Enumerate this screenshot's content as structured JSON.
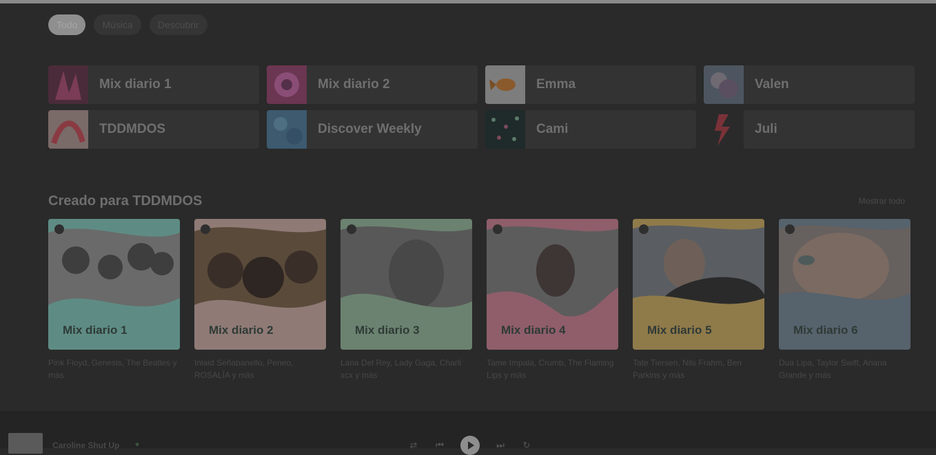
{
  "filters": [
    {
      "label": "Todo",
      "active": true
    },
    {
      "label": "Música",
      "active": false
    },
    {
      "label": "Descubrir",
      "active": false
    }
  ],
  "quick_access": [
    {
      "label": "Mix diario 1",
      "art": "art-mix1"
    },
    {
      "label": "Mix diario 2",
      "art": "art-mix2"
    },
    {
      "label": "Emma",
      "art": "art-emma"
    },
    {
      "label": "Valen",
      "art": "art-valen"
    },
    {
      "label": "TDDMDOS",
      "art": "art-tddmdos"
    },
    {
      "label": "Discover Weekly",
      "art": "art-discover"
    },
    {
      "label": "Cami",
      "art": "art-cami"
    },
    {
      "label": "Juli",
      "art": "art-juli"
    }
  ],
  "section": {
    "title": "Creado para TDDMDOS",
    "show_all": "Mostrar todo"
  },
  "mixes": [
    {
      "label": "Mix diario 1",
      "desc": "Pink Floyd, Genesis, The Beatles y más",
      "color": "#5e8c84"
    },
    {
      "label": "Mix diario 2",
      "desc": "Inlaid Señabanello, Peneo, ROSALÍA y más",
      "color": "#8f7a76"
    },
    {
      "label": "Mix diario 3",
      "desc": "Lana Del Rey, Lady Gaga, Charli xcx y más",
      "color": "#6b8270"
    },
    {
      "label": "Mix diario 4",
      "desc": "Tame Impala, Crumb, The Flaming Lips y más",
      "color": "#8f5e6a"
    },
    {
      "label": "Mix diario 5",
      "desc": "Tate Tiersen, Nils Frahm, Ben Parkins y más",
      "color": "#8f7a4a"
    },
    {
      "label": "Mix diario 6",
      "desc": "Dua Lipa, Taylor Swift, Ariana Grande y más",
      "color": "#56626c"
    }
  ],
  "player": {
    "track": "Caroline Shut Up",
    "heart": "♥",
    "controls": [
      "⇄",
      "⏮",
      "⏭",
      "↻"
    ]
  }
}
